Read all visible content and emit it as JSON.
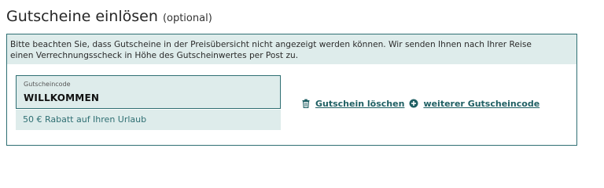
{
  "section": {
    "title": "Gutscheine einlösen",
    "optional_note": "(optional)"
  },
  "notice": {
    "line1": "Bitte beachten Sie, dass Gutscheine in der Preisübersicht nicht angezeigt werden können. Wir senden Ihnen nach Ihrer Reise",
    "line2": "einen Verrechnungsscheck in Höhe des Gutscheinwertes per Post zu."
  },
  "voucher": {
    "label": "Gutscheincode",
    "value": "WILLKOMMEN",
    "result": "50 € Rabatt auf Ihren Urlaub"
  },
  "actions": {
    "delete_label": "Gutschein löschen",
    "delete_icon": "trash-icon",
    "add_label": "weiterer Gutscheincode",
    "add_icon": "plus-circle-icon"
  },
  "colors": {
    "accent": "#2f6f73",
    "panel_tint": "#deeceb",
    "link": "#1f5f63"
  }
}
